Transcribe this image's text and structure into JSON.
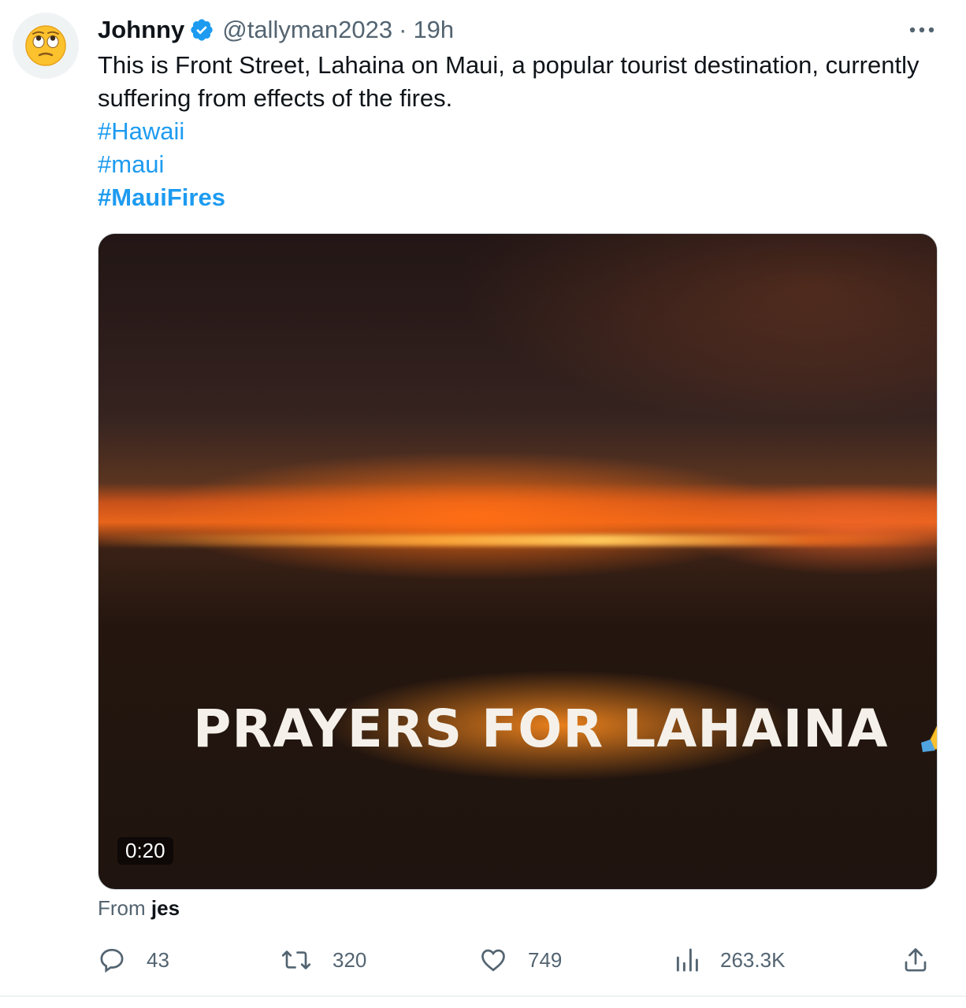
{
  "author": {
    "display_name": "Johnny",
    "handle": "@tallyman2023",
    "separator": "·",
    "time": "19h",
    "avatar_emoji": "🙄"
  },
  "tweet": {
    "text": "This is Front Street, Lahaina on Maui, a popular tourist destination, currently suffering from effects of the fires.",
    "hashtags": [
      "#Hawaii",
      "#maui",
      "#MauiFires"
    ]
  },
  "media": {
    "overlay_text": "PRAYERS FOR LAHAINA",
    "overlay_emoji": "🙏",
    "duration": "0:20"
  },
  "source": {
    "prefix": "From",
    "name": "jes"
  },
  "actions": {
    "replies": "43",
    "retweets": "320",
    "likes": "749",
    "views": "263.3K"
  },
  "colors": {
    "accent": "#1d9bf0",
    "secondary_text": "#536471",
    "primary_text": "#0f1419"
  }
}
